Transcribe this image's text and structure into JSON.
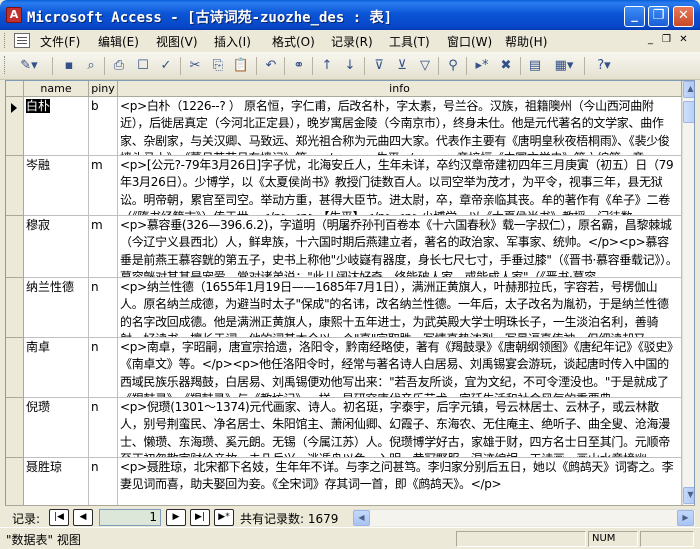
{
  "window": {
    "title": "Microsoft Access - [古诗词苑-zuozhe_des : 表]",
    "controls": [
      "minimize",
      "restore",
      "close"
    ]
  },
  "menu": {
    "items": [
      "文件(F)",
      "编辑(E)",
      "视图(V)",
      "插入(I)",
      "格式(O)",
      "记录(R)",
      "工具(T)",
      "窗口(W)",
      "帮助(H)"
    ]
  },
  "toolbar": {
    "icons": [
      "view-icon",
      "save-icon",
      "search-icon",
      "print-icon",
      "print-preview-icon",
      "spelling-icon",
      "cut-icon",
      "copy-icon",
      "paste-icon",
      "undo-icon",
      "hyperlink-icon",
      "sort-ascending-icon",
      "sort-descending-icon",
      "filter-by-selection-icon",
      "filter-by-form-icon",
      "apply-filter-icon",
      "find-icon",
      "new-record-icon",
      "delete-record-icon",
      "database-window-icon",
      "new-object-icon",
      "help-icon"
    ]
  },
  "table": {
    "columns": [
      {
        "key": "name",
        "label": "name"
      },
      {
        "key": "piny",
        "label": "piny"
      },
      {
        "key": "info",
        "label": "info"
      }
    ],
    "rows": [
      {
        "name_pre": "",
        "name_sel": "白朴",
        "piny": "b",
        "info": "<p>白朴（1226--? ） 原名恒，字仁甫，后改名朴，字太素，号兰谷。汉族，祖籍隩州（今山西河曲附近），后徙居真定（今河北正定县），晚岁寓居金陵（今南京市），终身未仕。他是元代著名的文学家、曲作家、杂剧家，与关汉卿、马致远、郑光祖合称为元曲四大家。代表作主要有《唐明皇秋夜梧桐雨》、《裴少俊墙头马上》、《董月英花月东墙记》等。</p><p>生平</p><p>章培恒《中国文学史》第六编第一章"
      },
      {
        "name_pre": "岑融",
        "name_sel": "",
        "piny": "m",
        "info": "<p>[公元?-79年3月26日]字子忧，北海安丘人，生年未详，卒约汉章帝建初四年三月庚寅（初五）日（79年3月26日）。少博学，以《太夏侯尚书》教授门徒数百人。以司空举为茂才，为平令，视事三年，县无狱讼。明帝朝，累官至司空。举动方重，甚得大臣节。进太尉，卒，章帝亲临其丧。牟的著作有《牟子》二卷（《隋书经籍志》）传于世。</p><p>【生平】</p><p>少博学，以《太夏侯尚书》教授，门徒数"
      },
      {
        "name_pre": "穆寂",
        "name_sel": "",
        "piny": "m",
        "info": "<p>慕容垂(326—396.6.2)，字道明（明屠乔孙刊百卷本《十六国春秋》载一字叔仁），原名霸，昌黎棘城（今辽宁义县西北）人，鲜卑族，十六国时期后燕建立者，著名的政治家、军事家、统帅。</p><p>慕容垂是前燕王慕容皝的第五子，史书上称他\"少岐嶷有器度，身长七尺七寸，手垂过膝\"（《晋书·慕容垂载记》）。慕容皝对其甚是宠爱，常对诸弟说：\"此儿阔达好奇，终能破人家，或能成人家\"（《晋书·慕容"
      },
      {
        "name_pre": "纳兰性德",
        "name_sel": "",
        "piny": "n",
        "info": "<p>纳兰性德（1655年1月19日——1685年7月1日），满洲正黄旗人，叶赫那拉氏，字容若，号楞伽山人。原名纳兰成德，为避当时太子\"保成\"的名讳，改名纳兰性德。一年后，太子改名为胤礽，于是纳兰性德的名字改回成德。他是满洲正黄旗人，康熙十五年进士，为武英殿大学士明珠长子，一生淡泊名利，善骑射、好读书、擅长于词。他的词基本全以一个\"真\"字取胜，写情真挚浓烈，写景逼真传神，但细读却又"
      },
      {
        "name_pre": "南卓",
        "name_sel": "",
        "piny": "n",
        "info": "<p>南卓，字昭嗣，唐宣宗拾遗，洛阳令，黔南经略使，著有《羯鼓录》《唐朝纲领图》《唐纪年记》《驳史》《南卓文》等。</p><p>他任洛阳令时，经常与著名诗人白居易、刘禹锡宴会游玩，谈起唐时传入中国的西域民族乐器羯鼓，白居易、刘禹锡便劝他写出来：\"若吾友所谈，宜为文纪，不可令湮没也。\"于是就成了《羯鼓录》。《羯鼓录》与《教坊记》一样，是研究唐代音乐艺术、宫廷生活和社会风气的重要典"
      },
      {
        "name_pre": "倪瓒",
        "name_sel": "",
        "piny": "n",
        "info": "<p>倪瓒(1301～1374)元代画家、诗人。初名珽，字泰宇，后字元镇，号云林居士、云林子，或云林散人，别号荆蛮民、净名居士、朱阳馆主、萧闲仙卿、幻霞子、东海农、无住庵主、绝听子、曲全叟、沧海漫士、懒瓒、东海瓒、奚元朗。无锡（今属江苏）人。倪瓒博学好古，家雄于财，四方名士日至其门。元顺帝至正初忽散家财给亲故，未几兵兴，逃遁舟以免。入明，黄冠野服，混迹编氓。工诗画，画山水意境幽"
      },
      {
        "name_pre": "聂胜琼",
        "name_sel": "",
        "piny": "n",
        "info": "<p>聂胜琼，北宋都下名妓，生年年不详。与李之问甚笃。李归家分别后五日，她以《鹧鸪天》词寄之。李妻见词而喜，助夫娶回为妾。《全宋词》存其词一首，即《鹧鸪天》。</p>"
      }
    ]
  },
  "navigation": {
    "label": "记录:",
    "current": "1",
    "total_text": "共有记录数: 1679"
  },
  "status": {
    "text": "\"数据表\" 视图",
    "num": "NUM"
  }
}
